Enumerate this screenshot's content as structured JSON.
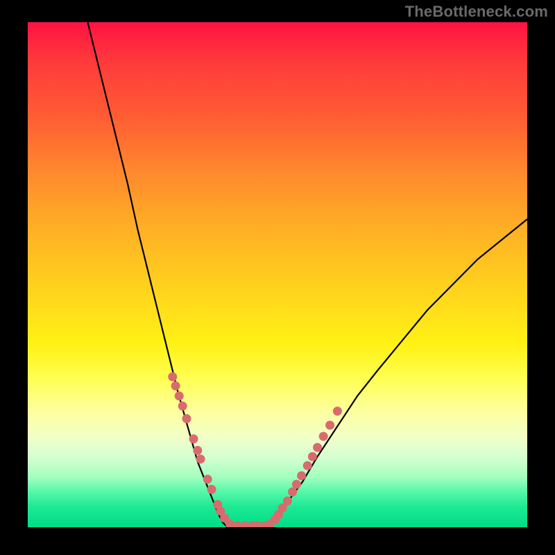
{
  "watermark": "TheBottleneck.com",
  "colors": {
    "background": "#000000",
    "curve": "#000000",
    "dot": "#d86b6d",
    "gradient_top": "#ff1242",
    "gradient_bottom": "#00dd86"
  },
  "chart_data": {
    "type": "line",
    "title": "",
    "xlabel": "",
    "ylabel": "",
    "xlim": [
      0,
      100
    ],
    "ylim": [
      0,
      100
    ],
    "grid": false,
    "legend": false,
    "series": [
      {
        "name": "bottleneck-curve-left",
        "x": [
          12,
          14,
          16,
          18,
          20,
          22,
          24,
          26,
          28,
          30,
          32,
          34,
          36,
          38,
          39,
          40
        ],
        "y": [
          100,
          92,
          84,
          76,
          68,
          59,
          51,
          43,
          35,
          27,
          20,
          13,
          8,
          3,
          1,
          0
        ]
      },
      {
        "name": "bottleneck-curve-flat",
        "x": [
          40,
          42,
          44,
          46,
          48
        ],
        "y": [
          0,
          0,
          0,
          0,
          0
        ]
      },
      {
        "name": "bottleneck-curve-right",
        "x": [
          48,
          50,
          52,
          55,
          58,
          62,
          66,
          70,
          75,
          80,
          85,
          90,
          95,
          100
        ],
        "y": [
          0,
          2,
          5,
          9,
          14,
          20,
          26,
          31,
          37,
          43,
          48,
          53,
          57,
          61
        ]
      }
    ],
    "dots_left": {
      "name": "data-points-left",
      "x": [
        29.0,
        29.6,
        30.3,
        31.0,
        31.8,
        33.2,
        34.0,
        34.6,
        36.0,
        36.8,
        38.0,
        38.6,
        39.4,
        40.5,
        42.0,
        43.5,
        45.0,
        46.0
      ],
      "y": [
        29.8,
        28.0,
        26.0,
        24.0,
        21.5,
        17.5,
        15.2,
        13.5,
        9.5,
        7.5,
        4.5,
        3.2,
        1.8,
        0.6,
        0.3,
        0.3,
        0.3,
        0.3
      ]
    },
    "dots_right": {
      "name": "data-points-right",
      "x": [
        47.5,
        48.5,
        49.5,
        50.2,
        51.0,
        52.0,
        53.0,
        53.8,
        54.8,
        56.0,
        57.0,
        58.0,
        59.2,
        60.5,
        62.0
      ],
      "y": [
        0.3,
        0.6,
        1.5,
        2.5,
        3.8,
        5.2,
        7.0,
        8.5,
        10.2,
        12.2,
        14.0,
        15.8,
        18.0,
        20.2,
        23.0
      ]
    }
  }
}
